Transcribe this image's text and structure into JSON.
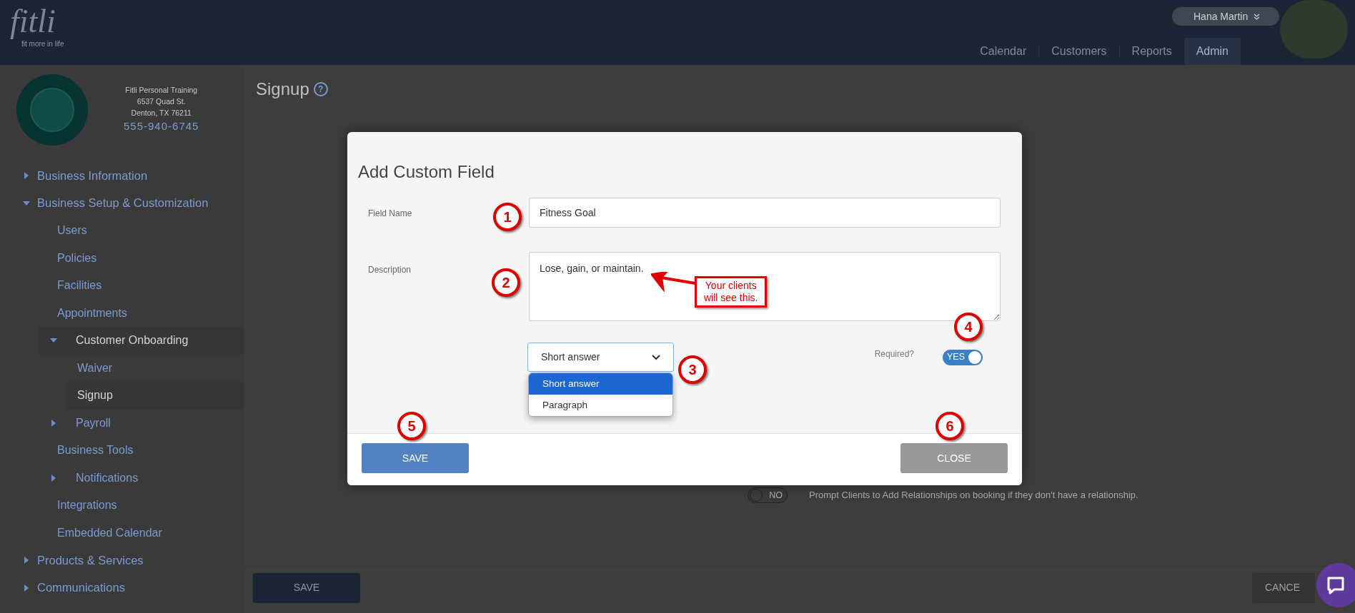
{
  "header": {
    "logo": "fitli",
    "tagline": "fit more in life",
    "user_name": "Hana Martin",
    "nav": [
      {
        "label": "Calendar",
        "selected": false
      },
      {
        "label": "Customers",
        "selected": false
      },
      {
        "label": "Reports",
        "selected": false
      },
      {
        "label": "Admin",
        "selected": true
      }
    ]
  },
  "business": {
    "name": "Fitli Personal Training",
    "street": "6537 Quad St.",
    "city": "Denton, TX 76211",
    "phone": "555-940-6745"
  },
  "sidebar": {
    "items": [
      {
        "label": "Business Information",
        "expandable": true,
        "expanded": false,
        "selected": false
      },
      {
        "label": "Business Setup & Customization",
        "expandable": true,
        "expanded": true,
        "selected": false,
        "children": [
          {
            "label": "Users",
            "expandable": false,
            "selected": false
          },
          {
            "label": "Policies",
            "expandable": false,
            "selected": false
          },
          {
            "label": "Facilities",
            "expandable": false,
            "selected": false
          },
          {
            "label": "Appointments",
            "expandable": false,
            "selected": false
          },
          {
            "label": "Customer Onboarding",
            "expandable": true,
            "expanded": true,
            "selected": true,
            "children": [
              {
                "label": "Waiver",
                "expandable": false,
                "selected": false
              },
              {
                "label": "Signup",
                "expandable": false,
                "selected": true
              }
            ]
          },
          {
            "label": "Payroll",
            "expandable": true,
            "expanded": false,
            "selected": false
          },
          {
            "label": "Business Tools",
            "expandable": false,
            "selected": false
          },
          {
            "label": "Notifications",
            "expandable": true,
            "expanded": false,
            "selected": false
          },
          {
            "label": "Integrations",
            "expandable": false,
            "selected": false
          },
          {
            "label": "Embedded Calendar",
            "expandable": false,
            "selected": false
          }
        ]
      },
      {
        "label": "Products & Services",
        "expandable": true,
        "expanded": false,
        "selected": false
      },
      {
        "label": "Communications",
        "expandable": true,
        "expanded": false,
        "selected": false
      }
    ]
  },
  "page": {
    "title": "Signup",
    "help_icon": "?",
    "relationship_toggle": {
      "label": "NO",
      "on": false
    },
    "relationship_text": "Prompt Clients to Add Relationships on booking if they don't have a relationship.",
    "buttons": [
      "SAVE",
      "CANCE"
    ]
  },
  "modal": {
    "title": "Add Custom Field",
    "field_name": {
      "label": "Field Name",
      "value": "Fitness Goal"
    },
    "description": {
      "label": "Description",
      "value": "Lose, gain, or maintain."
    },
    "type_select": {
      "value": "Short answer",
      "expanded": true,
      "options": [
        {
          "label": "Short answer",
          "selected": true
        },
        {
          "label": "Paragraph",
          "selected": false
        }
      ]
    },
    "required": {
      "label": "Required?",
      "toggle_label": "YES",
      "on": true
    },
    "buttons": [
      {
        "label": "SAVE",
        "kind": "primary"
      },
      {
        "label": "CLOSE",
        "kind": "secondary"
      }
    ]
  },
  "annotations": {
    "markers": [
      "1",
      "2",
      "3",
      "4",
      "5",
      "6"
    ],
    "callout": [
      "Your clients",
      "will see this."
    ]
  }
}
